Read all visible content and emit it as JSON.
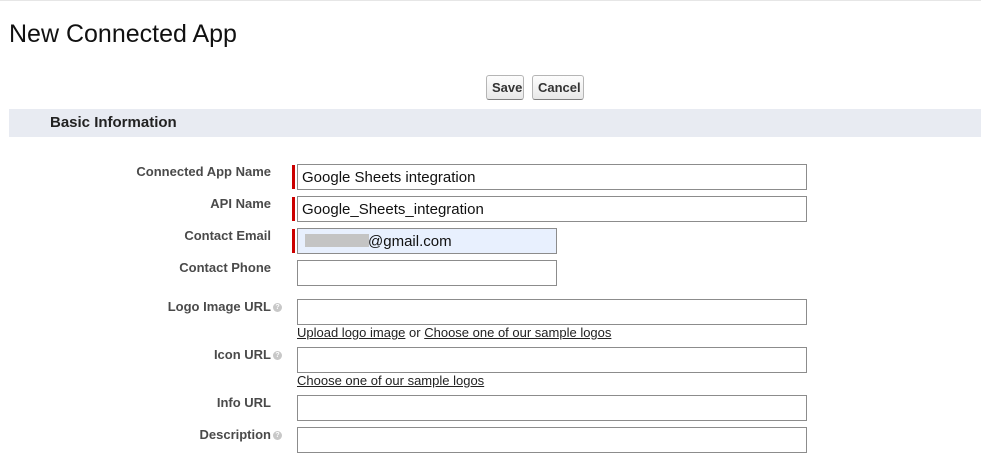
{
  "page": {
    "title": "New Connected App"
  },
  "buttons": {
    "save_label": "Save",
    "cancel_label": "Cancel"
  },
  "section": {
    "title": "Basic Information"
  },
  "fields": {
    "connected_app_name": {
      "label": "Connected App Name",
      "value": "Google Sheets integration",
      "required": true
    },
    "api_name": {
      "label": "API Name",
      "value": "Google_Sheets_integration",
      "required": true
    },
    "contact_email": {
      "label": "Contact Email",
      "value": "@gmail.com",
      "required": true
    },
    "contact_phone": {
      "label": "Contact Phone",
      "value": ""
    },
    "logo_image_url": {
      "label": "Logo Image URL",
      "value": "",
      "upload_link": "Upload logo image",
      "or_text": "or",
      "sample_link": "Choose one of our sample logos"
    },
    "icon_url": {
      "label": "Icon URL",
      "value": "",
      "sample_link": "Choose one of our sample logos"
    },
    "info_url": {
      "label": "Info URL",
      "value": ""
    },
    "description": {
      "label": "Description",
      "value": ""
    }
  },
  "icons": {
    "help": "help-icon"
  }
}
